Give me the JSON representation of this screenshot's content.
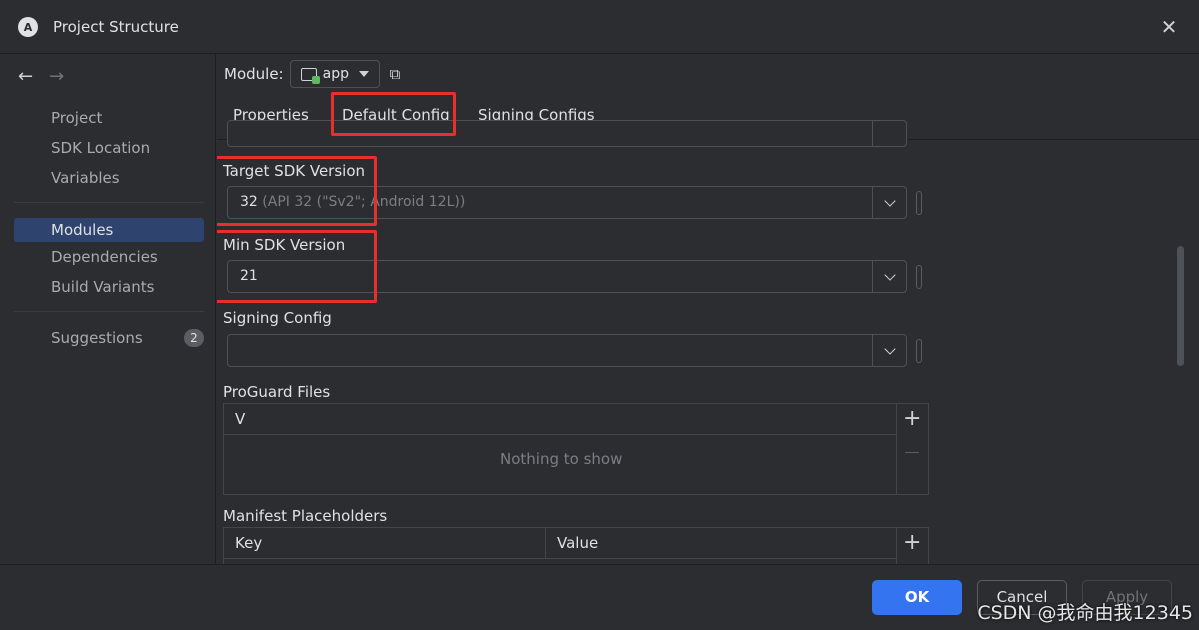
{
  "window": {
    "title": "Project Structure",
    "close_glyph": "✕"
  },
  "nav": {
    "back_glyph": "←",
    "forward_glyph": "→"
  },
  "sidebar": {
    "items": [
      {
        "label": "Project"
      },
      {
        "label": "SDK Location"
      },
      {
        "label": "Variables"
      },
      {
        "label": "Modules",
        "active": true
      },
      {
        "label": "Dependencies"
      },
      {
        "label": "Build Variants"
      },
      {
        "label": "Suggestions",
        "badge": "2"
      }
    ]
  },
  "module": {
    "label": "Module:",
    "value": "app"
  },
  "tabs": [
    {
      "label": "Properties"
    },
    {
      "label": "Default Config",
      "selected": true
    },
    {
      "label": "Signing Configs"
    }
  ],
  "fields": {
    "target_sdk": {
      "label": "Target SDK Version",
      "value": "32",
      "hint": " (API 32 (\"Sv2\"; Android 12L))"
    },
    "min_sdk": {
      "label": "Min SDK Version",
      "value": "21"
    },
    "signing_config": {
      "label": "Signing Config",
      "value": ""
    }
  },
  "proguard": {
    "label": "ProGuard Files",
    "column": "V",
    "empty_text": "Nothing to show"
  },
  "manifest": {
    "label": "Manifest Placeholders",
    "columns": [
      "Key",
      "Value"
    ]
  },
  "footer": {
    "ok": "OK",
    "cancel": "Cancel",
    "apply": "Apply"
  },
  "watermark": "CSDN @我命由我12345",
  "colors": {
    "accent": "#3574f0",
    "highlight": "#e8302b",
    "selection": "#2e436e"
  },
  "icons": {
    "plus": "+"
  }
}
